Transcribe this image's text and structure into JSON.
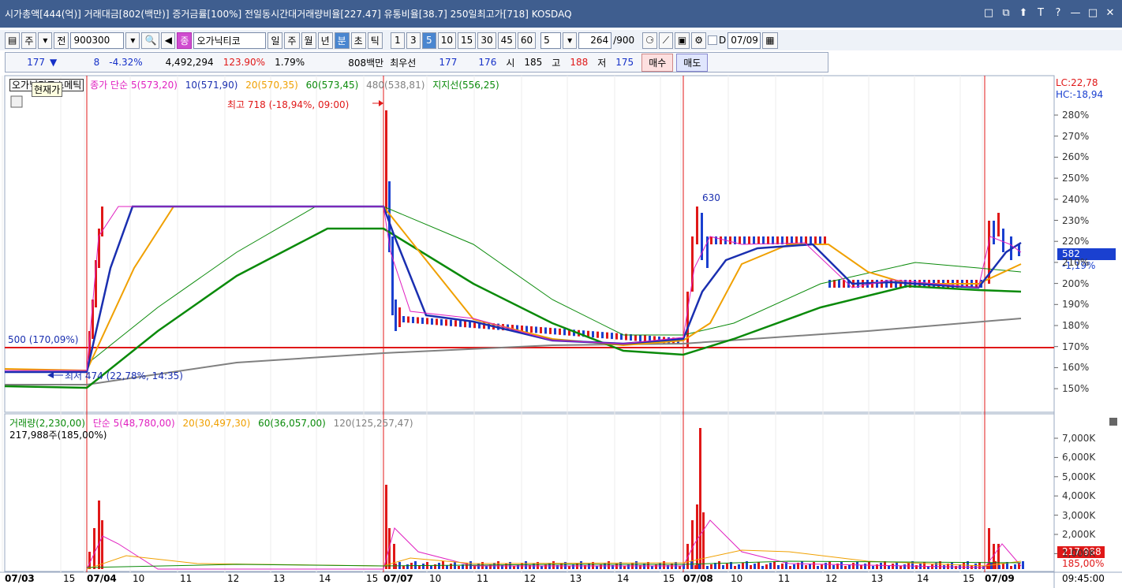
{
  "titlebar": {
    "text": "시가총액[444(억)] 거래대금[802(백만)] 증거금률[100%] 전일동시간대거래량비율[227.47] 유통비율[38.7] 250일최고가[718] KOSDAQ",
    "window_icons": [
      "□",
      "⧉",
      "⬆",
      "T",
      "?",
      "—",
      "□",
      "✕"
    ]
  },
  "toolbar": {
    "mode_main": "주",
    "mode_all": "전",
    "code": "900300",
    "stock_badge": "종",
    "stock_name": "오가닉티코",
    "periods": [
      "일",
      "주",
      "월",
      "년",
      "분",
      "초",
      "틱"
    ],
    "period_selected": "분",
    "minutes": [
      "1",
      "3",
      "5",
      "10",
      "15",
      "30",
      "45",
      "60"
    ],
    "minute_selected": "5",
    "interval_value": "5",
    "count_value": "264",
    "count_total": "/900",
    "checkbox_label": "D",
    "date_value": "07/09"
  },
  "quote": {
    "price": "177",
    "arrow": "▼",
    "change": "8",
    "change_pct": "-4.32%",
    "volume": "4,492,294",
    "vol_ratio": "123.90%",
    "turnover": "1.79%",
    "amount": "808백만",
    "best_label": "최우선",
    "best_ask": "177",
    "best_bid": "176",
    "open_label": "시",
    "open": "185",
    "high_label": "고",
    "high": "188",
    "low_label": "저",
    "low": "175",
    "buy_button": "매수",
    "sell_button": "매도"
  },
  "price_panel": {
    "stock_label": "오가닉티코스메틱",
    "tooltip": "현재가",
    "legend_close": "종가 단순 5(573,20)",
    "legend_10": "10(571,90)",
    "legend_20": "20(570,35)",
    "legend_60": "60(573,45)",
    "legend_480": "480(538,81)",
    "legend_support": "지지선(556,25)",
    "high_annotation": "최고 718 (-18,94%, 09:00)",
    "low_annotation": "최저 474 (22,78%, 14:35)",
    "support_annotation": "500 (170,09%)",
    "peak_label": "630",
    "lc": "LC:22,78",
    "hc": "HC:-18,94",
    "current_price_tag": "582",
    "current_pct": "-1,19%",
    "y_ticks": [
      "280%",
      "270%",
      "260%",
      "250%",
      "240%",
      "230%",
      "220%",
      "210%",
      "200%",
      "190%",
      "180%",
      "170%",
      "160%",
      "150%"
    ]
  },
  "volume_panel": {
    "legend_vol": "거래량(2,230,00)",
    "legend_ma5": "단순 5(48,780,00)",
    "legend_ma20": "20(30,497,30)",
    "legend_ma60": "60(36,057,00)",
    "legend_ma120": "120(125,257,47)",
    "sub_label": "217,988주(185,00%)",
    "y_ticks": [
      "7,000K",
      "6,000K",
      "5,000K",
      "4,000K",
      "3,000K",
      "2,000K",
      "1,000K"
    ],
    "current_vol_tag": "217,988",
    "current_vol_pct": "185,00%"
  },
  "x_axis": {
    "labels": [
      "07/03",
      "15",
      "07/04",
      "10",
      "11",
      "12",
      "13",
      "14",
      "15",
      "07/07",
      "10",
      "11",
      "12",
      "13",
      "14",
      "15",
      "07/08",
      "10",
      "11",
      "12",
      "13",
      "14",
      "15",
      "07/09"
    ],
    "bold_labels": [
      "07/03",
      "07/04",
      "07/07",
      "07/08",
      "07/09"
    ],
    "time": "09:45:00"
  },
  "colors": {
    "titlebar": "#3f5e8f",
    "ma5": "#e020c0",
    "ma10": "#1a2fb0",
    "ma20": "#f0a000",
    "ma60": "#0a8a0a",
    "ma480": "#808080",
    "support": "#e01818",
    "up": "#e01818",
    "down": "#1a40d0"
  }
}
